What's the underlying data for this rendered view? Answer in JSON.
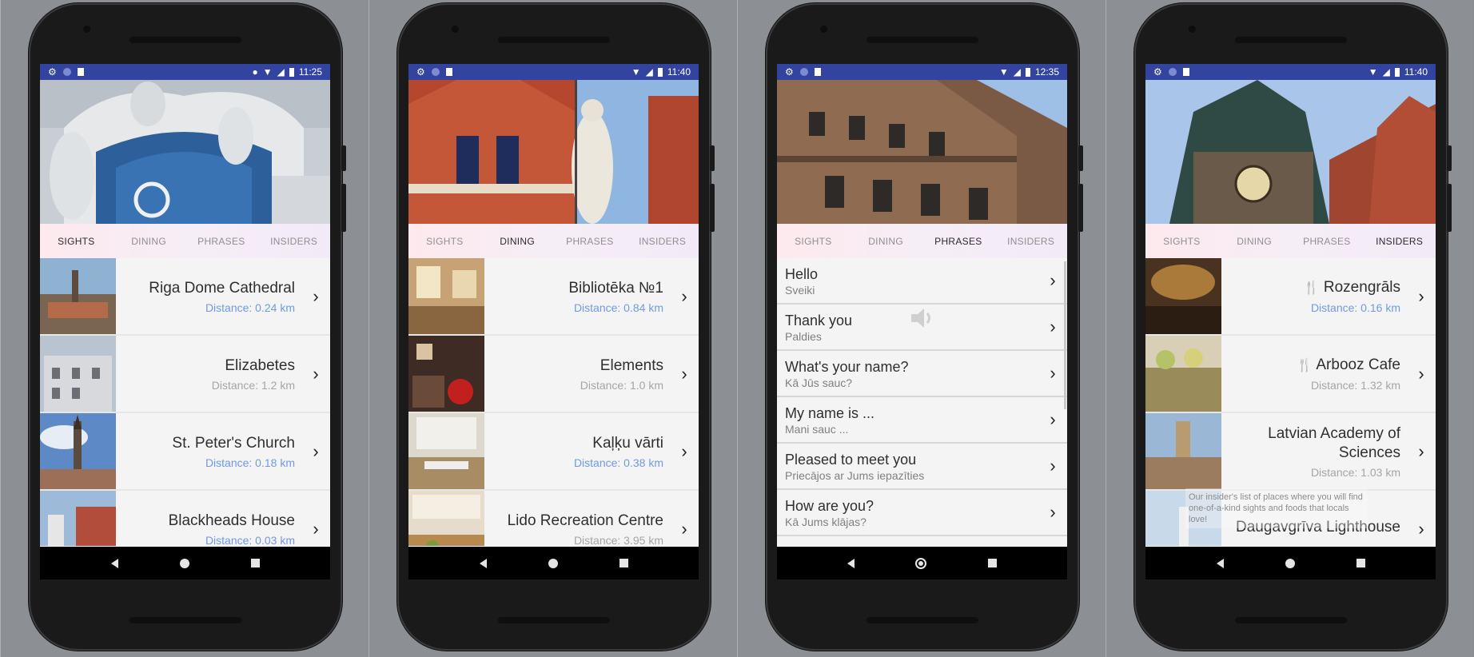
{
  "screens": [
    {
      "status_time": "11:25",
      "tabs": [
        "SIGHTS",
        "DINING",
        "PHRASES",
        "INSIDERS"
      ],
      "items": [
        {
          "title": "Riga Dome Cathedral",
          "distance": "Distance: 0.24 km",
          "dist_color": "blue"
        },
        {
          "title": "Elizabetes",
          "distance": "Distance: 1.2 km",
          "dist_color": "grey"
        },
        {
          "title": "St. Peter's Church",
          "distance": "Distance: 0.18 km",
          "dist_color": "blue"
        },
        {
          "title": "Blackheads House",
          "distance": "Distance: 0.03 km",
          "dist_color": "blue"
        }
      ]
    },
    {
      "status_time": "11:40",
      "tabs": [
        "SIGHTS",
        "DINING",
        "PHRASES",
        "INSIDERS"
      ],
      "items": [
        {
          "title": "Bibliotēka №1",
          "distance": "Distance: 0.84 km",
          "dist_color": "blue"
        },
        {
          "title": "Elements",
          "distance": "Distance: 1.0 km",
          "dist_color": "grey"
        },
        {
          "title": "Kaļķu vārti",
          "distance": "Distance: 0.38 km",
          "dist_color": "blue"
        },
        {
          "title": "Lido Recreation Centre",
          "distance": "Distance: 3.95 km",
          "dist_color": "grey"
        }
      ]
    },
    {
      "status_time": "12:35",
      "tabs": [
        "SIGHTS",
        "DINING",
        "PHRASES",
        "INSIDERS"
      ],
      "phrases": [
        {
          "en": "Hello",
          "lv": "Sveiki"
        },
        {
          "en": "Thank you",
          "lv": "Paldies"
        },
        {
          "en": "What's your name?",
          "lv": "Kā Jūs sauc?"
        },
        {
          "en": "My name is ...",
          "lv": "Mani sauc ..."
        },
        {
          "en": "Pleased to meet you",
          "lv": "Priecājos ar Jums iepazīties"
        },
        {
          "en": "How are you?",
          "lv": "Kā Jums klājas?"
        }
      ]
    },
    {
      "status_time": "11:40",
      "tabs": [
        "SIGHTS",
        "DINING",
        "PHRASES",
        "INSIDERS"
      ],
      "items": [
        {
          "title": "Rozengrāls",
          "distance": "Distance: 0.16 km",
          "dist_color": "blue",
          "fork": true
        },
        {
          "title": "Arbooz Cafe",
          "distance": "Distance: 1.32 km",
          "dist_color": "grey",
          "fork": true
        },
        {
          "title": "Latvian Academy of Sciences",
          "distance": "Distance: 1.03 km",
          "dist_color": "grey"
        },
        {
          "title": "Daugavgrīva Lighthouse",
          "distance": "",
          "dist_color": "grey"
        }
      ],
      "tooltip": "Our insider's list of places where you will find one-of-a-kind sights and foods that locals love!"
    }
  ],
  "colors": {
    "statusbar": "#3343a0",
    "distance_blue": "#6f9be0",
    "distance_grey": "#a5a5a5"
  },
  "icons": [
    "gear-icon",
    "circle-icon",
    "sdcard-icon",
    "location-icon",
    "wifi-icon",
    "signal-icon",
    "battery-icon",
    "chevron-right-icon",
    "back-icon",
    "home-icon",
    "recents-icon",
    "speaker-icon",
    "fork-knife-icon"
  ]
}
